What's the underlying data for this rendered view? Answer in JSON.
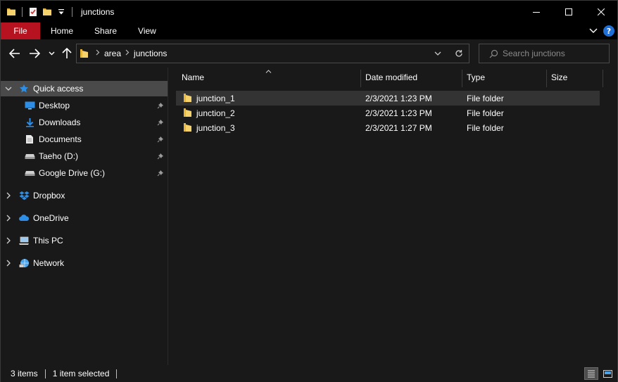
{
  "window": {
    "title": "junctions"
  },
  "ribbon": {
    "tabs": [
      {
        "label": "File"
      },
      {
        "label": "Home"
      },
      {
        "label": "Share"
      },
      {
        "label": "View"
      }
    ],
    "help_icon": "?"
  },
  "address": {
    "crumbs": [
      "area",
      "junctions"
    ]
  },
  "search": {
    "placeholder": "Search junctions"
  },
  "nav": {
    "quick_access": {
      "label": "Quick access",
      "icon": "star-icon"
    },
    "pinned": [
      {
        "label": "Desktop",
        "icon": "desktop-icon"
      },
      {
        "label": "Downloads",
        "icon": "download-icon"
      },
      {
        "label": "Documents",
        "icon": "documents-icon"
      },
      {
        "label": "Taeho (D:)",
        "icon": "drive-icon"
      },
      {
        "label": "Google Drive (G:)",
        "icon": "drive-icon"
      }
    ],
    "roots": [
      {
        "label": "Dropbox",
        "icon": "dropbox-icon"
      },
      {
        "label": "OneDrive",
        "icon": "onedrive-icon"
      },
      {
        "label": "This PC",
        "icon": "computer-icon"
      },
      {
        "label": "Network",
        "icon": "network-icon"
      }
    ]
  },
  "columns": [
    {
      "label": "Name"
    },
    {
      "label": "Date modified"
    },
    {
      "label": "Type"
    },
    {
      "label": "Size"
    }
  ],
  "files": [
    {
      "name": "junction_1",
      "modified": "2/3/2021 1:23 PM",
      "type": "File folder",
      "size": ""
    },
    {
      "name": "junction_2",
      "modified": "2/3/2021 1:23 PM",
      "type": "File folder",
      "size": ""
    },
    {
      "name": "junction_3",
      "modified": "2/3/2021 1:27 PM",
      "type": "File folder",
      "size": ""
    }
  ],
  "status": {
    "item_count": "3 items",
    "selection": "1 item selected"
  },
  "colors": {
    "background": "#191919",
    "titlebar": "#000000",
    "file_tab": "#b7121f",
    "selection": "#4a4a4a",
    "folder": "#e8b73a",
    "accent": "#1f6fd6"
  }
}
